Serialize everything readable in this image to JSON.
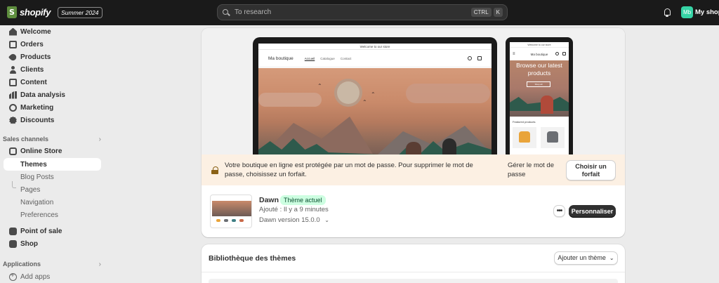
{
  "topbar": {
    "logo_text": "shopify",
    "edition_badge": "Summer 2024",
    "search_placeholder": "To research",
    "shortcut_keys": [
      "CTRL",
      "K"
    ],
    "avatar_initials": "Mb",
    "shop_name": "My shop"
  },
  "sidebar": {
    "items": [
      {
        "label": "Welcome",
        "icon": "home-icon"
      },
      {
        "label": "Orders",
        "icon": "orders-icon"
      },
      {
        "label": "Products",
        "icon": "tag-icon"
      },
      {
        "label": "Clients",
        "icon": "person-icon"
      },
      {
        "label": "Content",
        "icon": "content-icon"
      },
      {
        "label": "Data analysis",
        "icon": "chart-icon"
      },
      {
        "label": "Marketing",
        "icon": "target-icon"
      },
      {
        "label": "Discounts",
        "icon": "discount-icon"
      }
    ],
    "sales_channels_label": "Sales channels",
    "online_store_label": "Online Store",
    "online_store_subitems": [
      "Themes",
      "Blog Posts",
      "Pages",
      "Navigation",
      "Preferences"
    ],
    "point_of_sale_label": "Point of sale",
    "shop_label": "Shop",
    "applications_label": "Applications",
    "add_apps_label": "Add apps"
  },
  "preview": {
    "desktop_announcement": "Welcome to our store",
    "desktop_store_name": "Ma boutique",
    "desktop_nav": [
      "Accueil",
      "Catalogue",
      "Contact"
    ],
    "phone_announcement": "Welcome to our store",
    "phone_store_name": "Ma boutique",
    "phone_hero_text": "Browse our latest products",
    "phone_hero_button": "Shop all",
    "phone_featured_label": "Featured products"
  },
  "notice": {
    "text": "Votre boutique en ligne est protégée par un mot de passe. Pour supprimer le mot de passe, choisissez un forfait.",
    "manage_link": "Gérer le mot de passe",
    "choose_button": "Choisir un forfait"
  },
  "theme": {
    "name": "Dawn",
    "badge": "Thème actuel",
    "added": "Ajouté : Il y a 9 minutes",
    "version": "Dawn version 15.0.0",
    "more_button": "•••",
    "customize_button": "Personnaliser"
  },
  "library": {
    "title": "Bibliothèque des thèmes",
    "add_button": "Ajouter un thème"
  },
  "colors": {
    "topbar_bg": "#1a1a1a",
    "avatar_bg": "#36d3a5",
    "notice_bg": "#fcf0e3",
    "badge_bg": "#cdfee1",
    "primary_button": "#303030"
  }
}
